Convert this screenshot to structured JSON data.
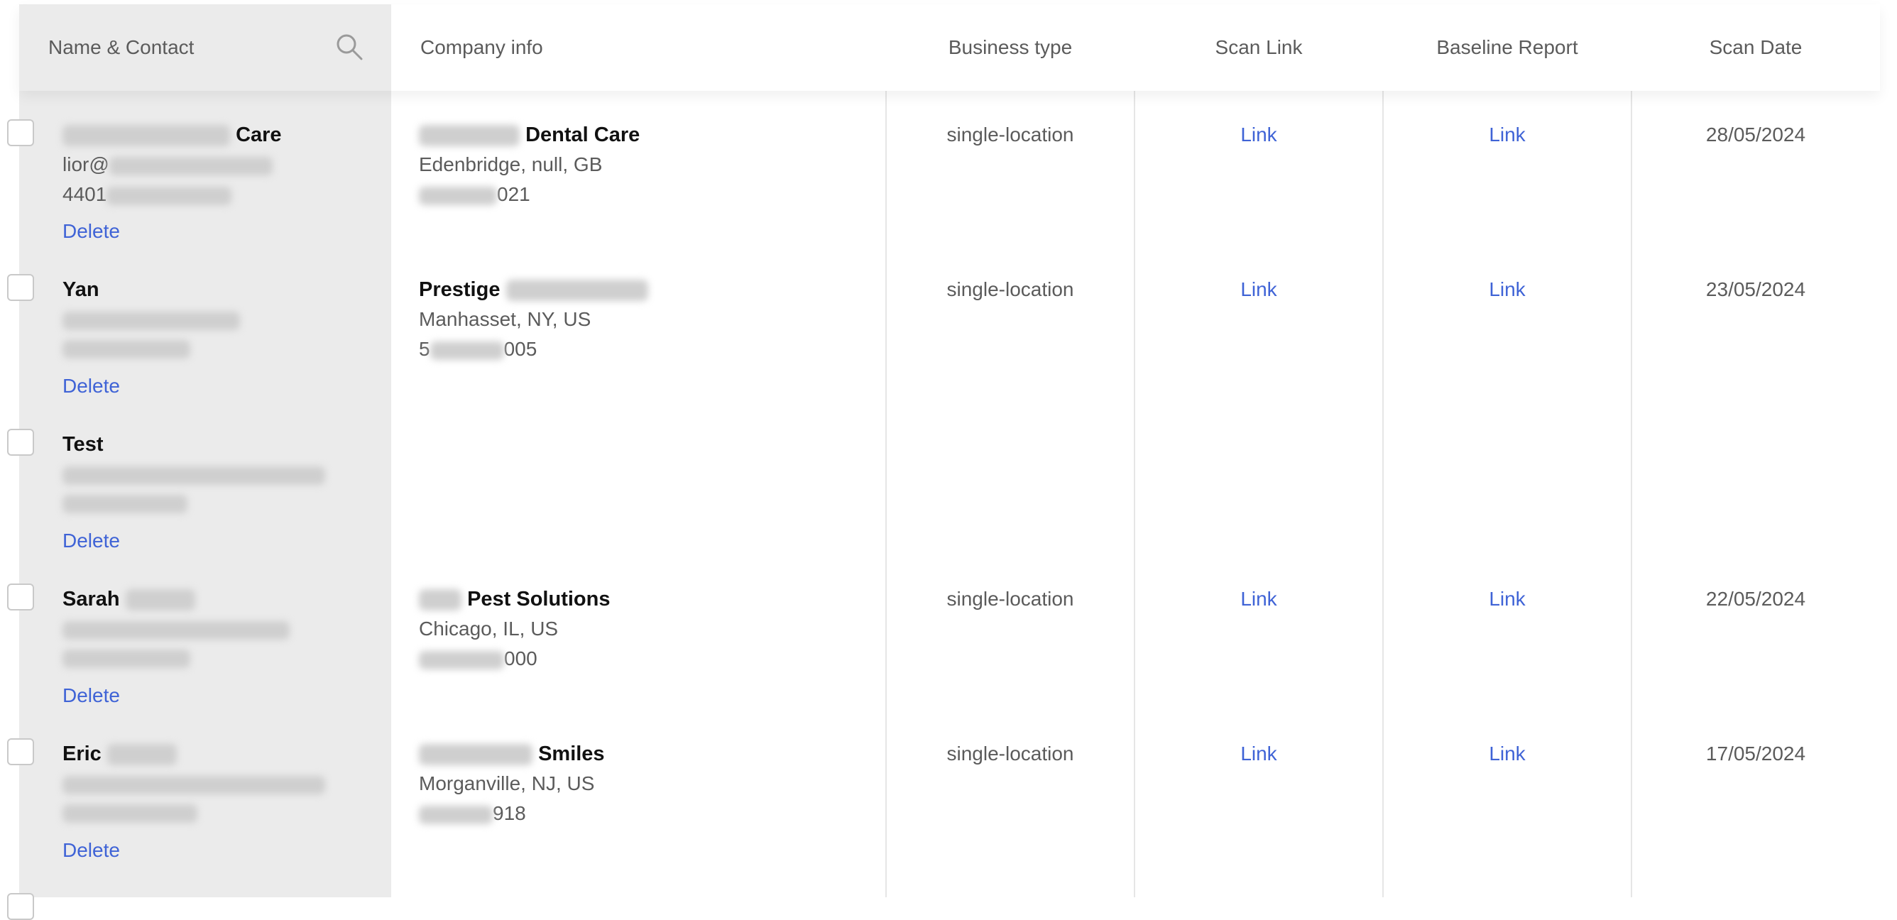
{
  "header": {
    "name_contact": "Name & Contact",
    "company_info": "Company info",
    "business_type": "Business type",
    "scan_link": "Scan Link",
    "baseline_report": "Baseline Report",
    "scan_date": "Scan Date"
  },
  "rows": [
    {
      "name_suffix": "Care",
      "email_prefix": "lior@",
      "phone_prefix": "4401",
      "delete": "Delete",
      "company_suffix": "Dental Care",
      "location": "Edenbridge, null, GB",
      "company_phone_suffix": "021",
      "business_type": "single-location",
      "scan_link": "Link",
      "baseline_link": "Link",
      "scan_date": "28/05/2024"
    },
    {
      "name": "Yan",
      "delete": "Delete",
      "company_prefix": "Prestige",
      "location": "Manhasset, NY, US",
      "company_phone_prefix": "5",
      "company_phone_suffix": "005",
      "business_type": "single-location",
      "scan_link": "Link",
      "baseline_link": "Link",
      "scan_date": "23/05/2024"
    },
    {
      "name": "Test",
      "delete": "Delete"
    },
    {
      "name": "Sarah",
      "delete": "Delete",
      "company_suffix": "Pest Solutions",
      "location": "Chicago, IL, US",
      "company_phone_suffix": "000",
      "business_type": "single-location",
      "scan_link": "Link",
      "baseline_link": "Link",
      "scan_date": "22/05/2024"
    },
    {
      "name": "Eric",
      "delete": "Delete",
      "company_suffix": "Smiles",
      "location": "Morganville, NJ, US",
      "company_phone_suffix": "918",
      "business_type": "single-location",
      "scan_link": "Link",
      "baseline_link": "Link",
      "scan_date": "17/05/2024"
    }
  ],
  "colors": {
    "link": "#3f63d6",
    "sidebar_bg": "#ebebeb",
    "muted_text": "#5b5b5b"
  },
  "icons": [
    "search-icon"
  ]
}
